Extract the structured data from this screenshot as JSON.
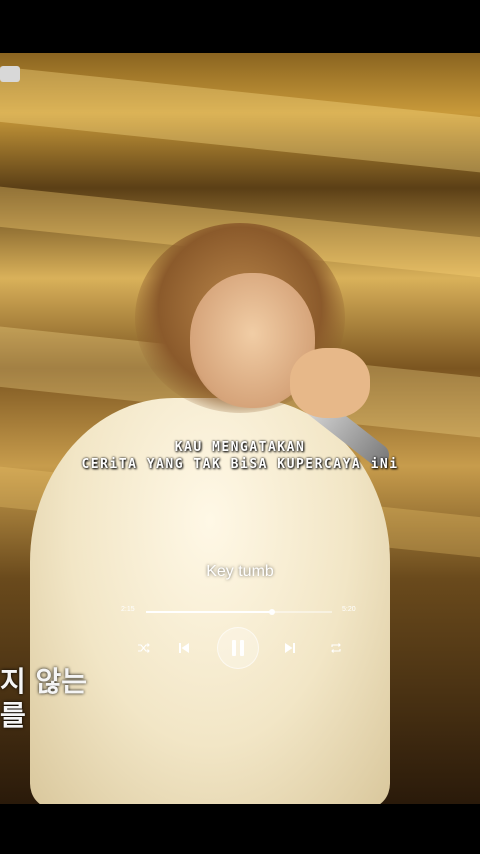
{
  "lyrics": {
    "line1": "KAU MENGATAKAN",
    "line2": "CERiTA YANG TAK BiSA KUPERCAYA iNi"
  },
  "video_overlay": {
    "korean_line1": "지 않는",
    "korean_line2": "를"
  },
  "player": {
    "track_title": "Key tumb",
    "time_elapsed": "2:15",
    "time_total": "5:20",
    "progress_fraction": 0.68,
    "controls": [
      "shuffle-icon",
      "previous-icon",
      "pause-icon",
      "next-icon",
      "repeat-icon"
    ]
  },
  "colors": {
    "accent": "#ffffff",
    "stage_gold": "#c99a3a"
  }
}
